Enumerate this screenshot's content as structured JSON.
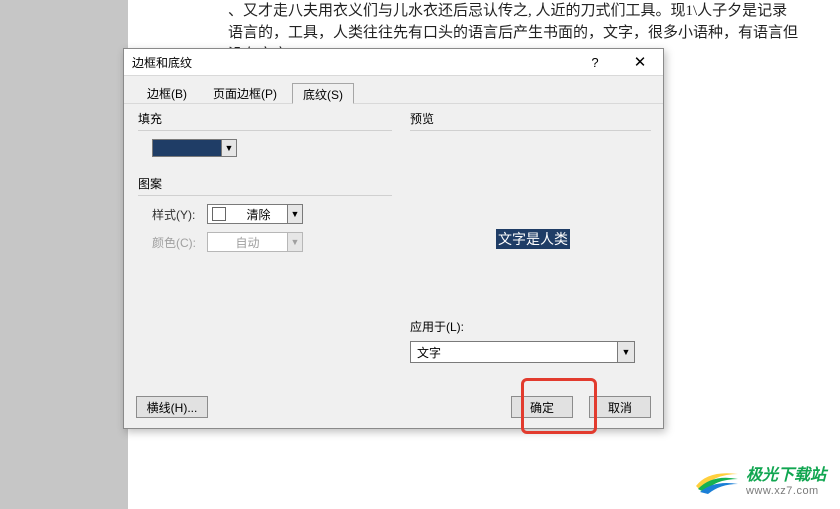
{
  "background_text": "、又才走八夫用衣义们与儿水衣还后忌认传之, 人近的刀式们工具。现1\\人子夕是记录语言的，工具，人类往往先有口头的语言后产生书面的，文字，很多小语种，有语言但没有文字。↙",
  "dialog": {
    "title": "边框和底纹",
    "help": "?",
    "close": "✕",
    "tabs": {
      "border": "边框(B)",
      "page_border": "页面边框(P)",
      "shading": "底纹(S)"
    },
    "fill_label": "填充",
    "fill_color": "#1f3d66",
    "pattern_label": "图案",
    "style_label": "样式(Y):",
    "style_value": "清除",
    "color_label": "颜色(C):",
    "color_value": "自动",
    "preview_label": "预览",
    "preview_text": "文字是人类",
    "apply_label": "应用于(L):",
    "apply_value": "文字",
    "hline_btn": "横线(H)...",
    "ok_btn": "确定",
    "cancel_btn": "取消"
  },
  "watermark": {
    "name": "极光下载站",
    "url": "www.xz7.com"
  }
}
